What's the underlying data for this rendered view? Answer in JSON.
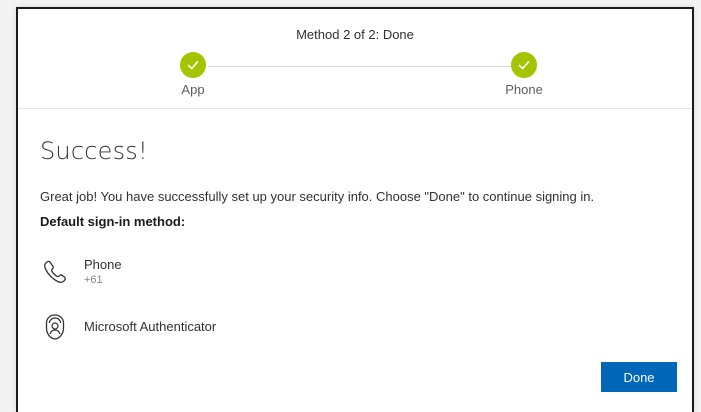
{
  "header": {
    "step_title": "Method 2 of 2: Done",
    "steps": [
      {
        "label": "App",
        "status": "complete"
      },
      {
        "label": "Phone",
        "status": "complete"
      }
    ]
  },
  "main": {
    "title": "Success!",
    "message": "Great job! You have successfully set up your security info. Choose \"Done\" to continue signing in.",
    "default_method_label": "Default sign-in method:",
    "methods": [
      {
        "name": "Phone",
        "detail": "+61",
        "icon": "phone-icon"
      },
      {
        "name": "Microsoft Authenticator",
        "icon": "authenticator-icon"
      }
    ]
  },
  "footer": {
    "done_label": "Done"
  },
  "colors": {
    "accent": "#0067b8",
    "check_green": "#a4c400"
  }
}
